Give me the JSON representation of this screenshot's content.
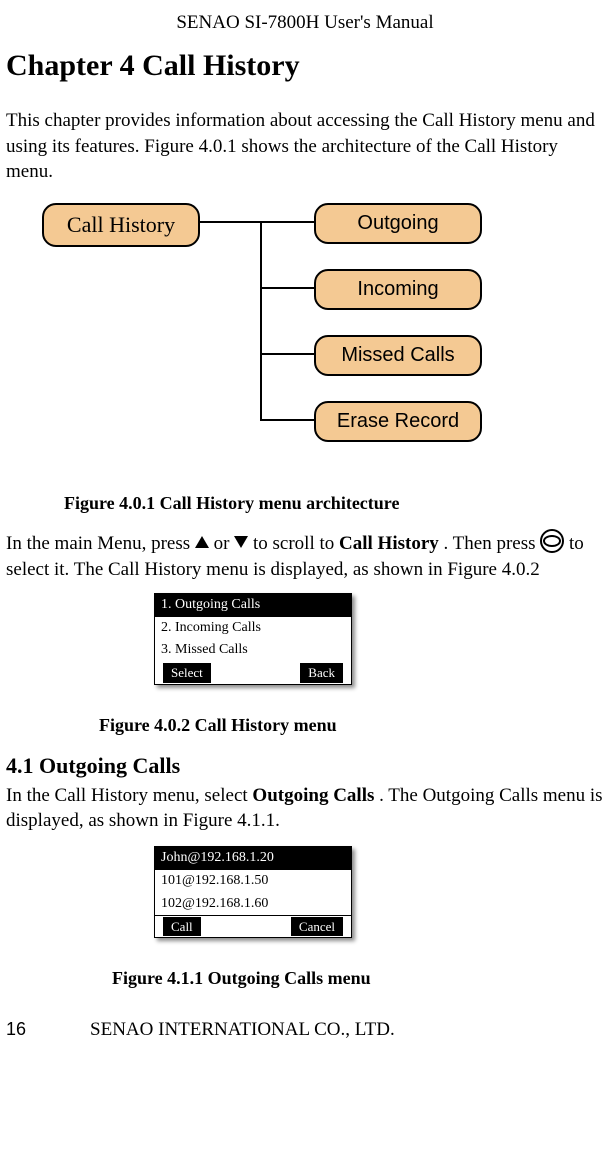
{
  "header": "SENAO SI-7800H User's Manual",
  "chapter_title": "Chapter 4 Call History",
  "intro": {
    "p1a": "This chapter provides information about accessing the Call History menu and using its features. Figure 4.0.1 shows the architecture of the Call History menu."
  },
  "diagram": {
    "root": "Call History",
    "children": [
      "Outgoing",
      "Incoming",
      "Missed Calls",
      "Erase Record"
    ]
  },
  "fig_4_0_1": "Figure 4.0.1 Call History menu architecture",
  "nav_para": {
    "a": "In the main Menu, press ",
    "or": " or ",
    "b": " to scroll to ",
    "target": "Call History",
    "c": ". Then press ",
    "d": " to select it. The Call History menu is displayed, as shown in Figure 4.0.2"
  },
  "screen_4_0_2": {
    "row1": "1. Outgoing Calls",
    "row2": "2. Incoming Calls",
    "row3": "3. Missed Calls",
    "left": "Select",
    "right": "Back"
  },
  "fig_4_0_2": "Figure 4.0.2 Call History menu",
  "section_4_1_heading": "4.1 Outgoing Calls",
  "section_4_1_para": {
    "a": "In the Call History menu, select ",
    "target": "Outgoing Calls",
    "b": ". The Outgoing Calls menu is displayed, as shown in Figure 4.1.1."
  },
  "screen_4_1_1": {
    "row1": "John@192.168.1.20",
    "row2": "101@192.168.1.50",
    "row3": "102@192.168.1.60",
    "left": "Call",
    "right": "Cancel"
  },
  "fig_4_1_1": "Figure 4.1.1 Outgoing Calls menu",
  "page_number": "16",
  "footer_company": "SENAO INTERNATIONAL CO., LTD."
}
